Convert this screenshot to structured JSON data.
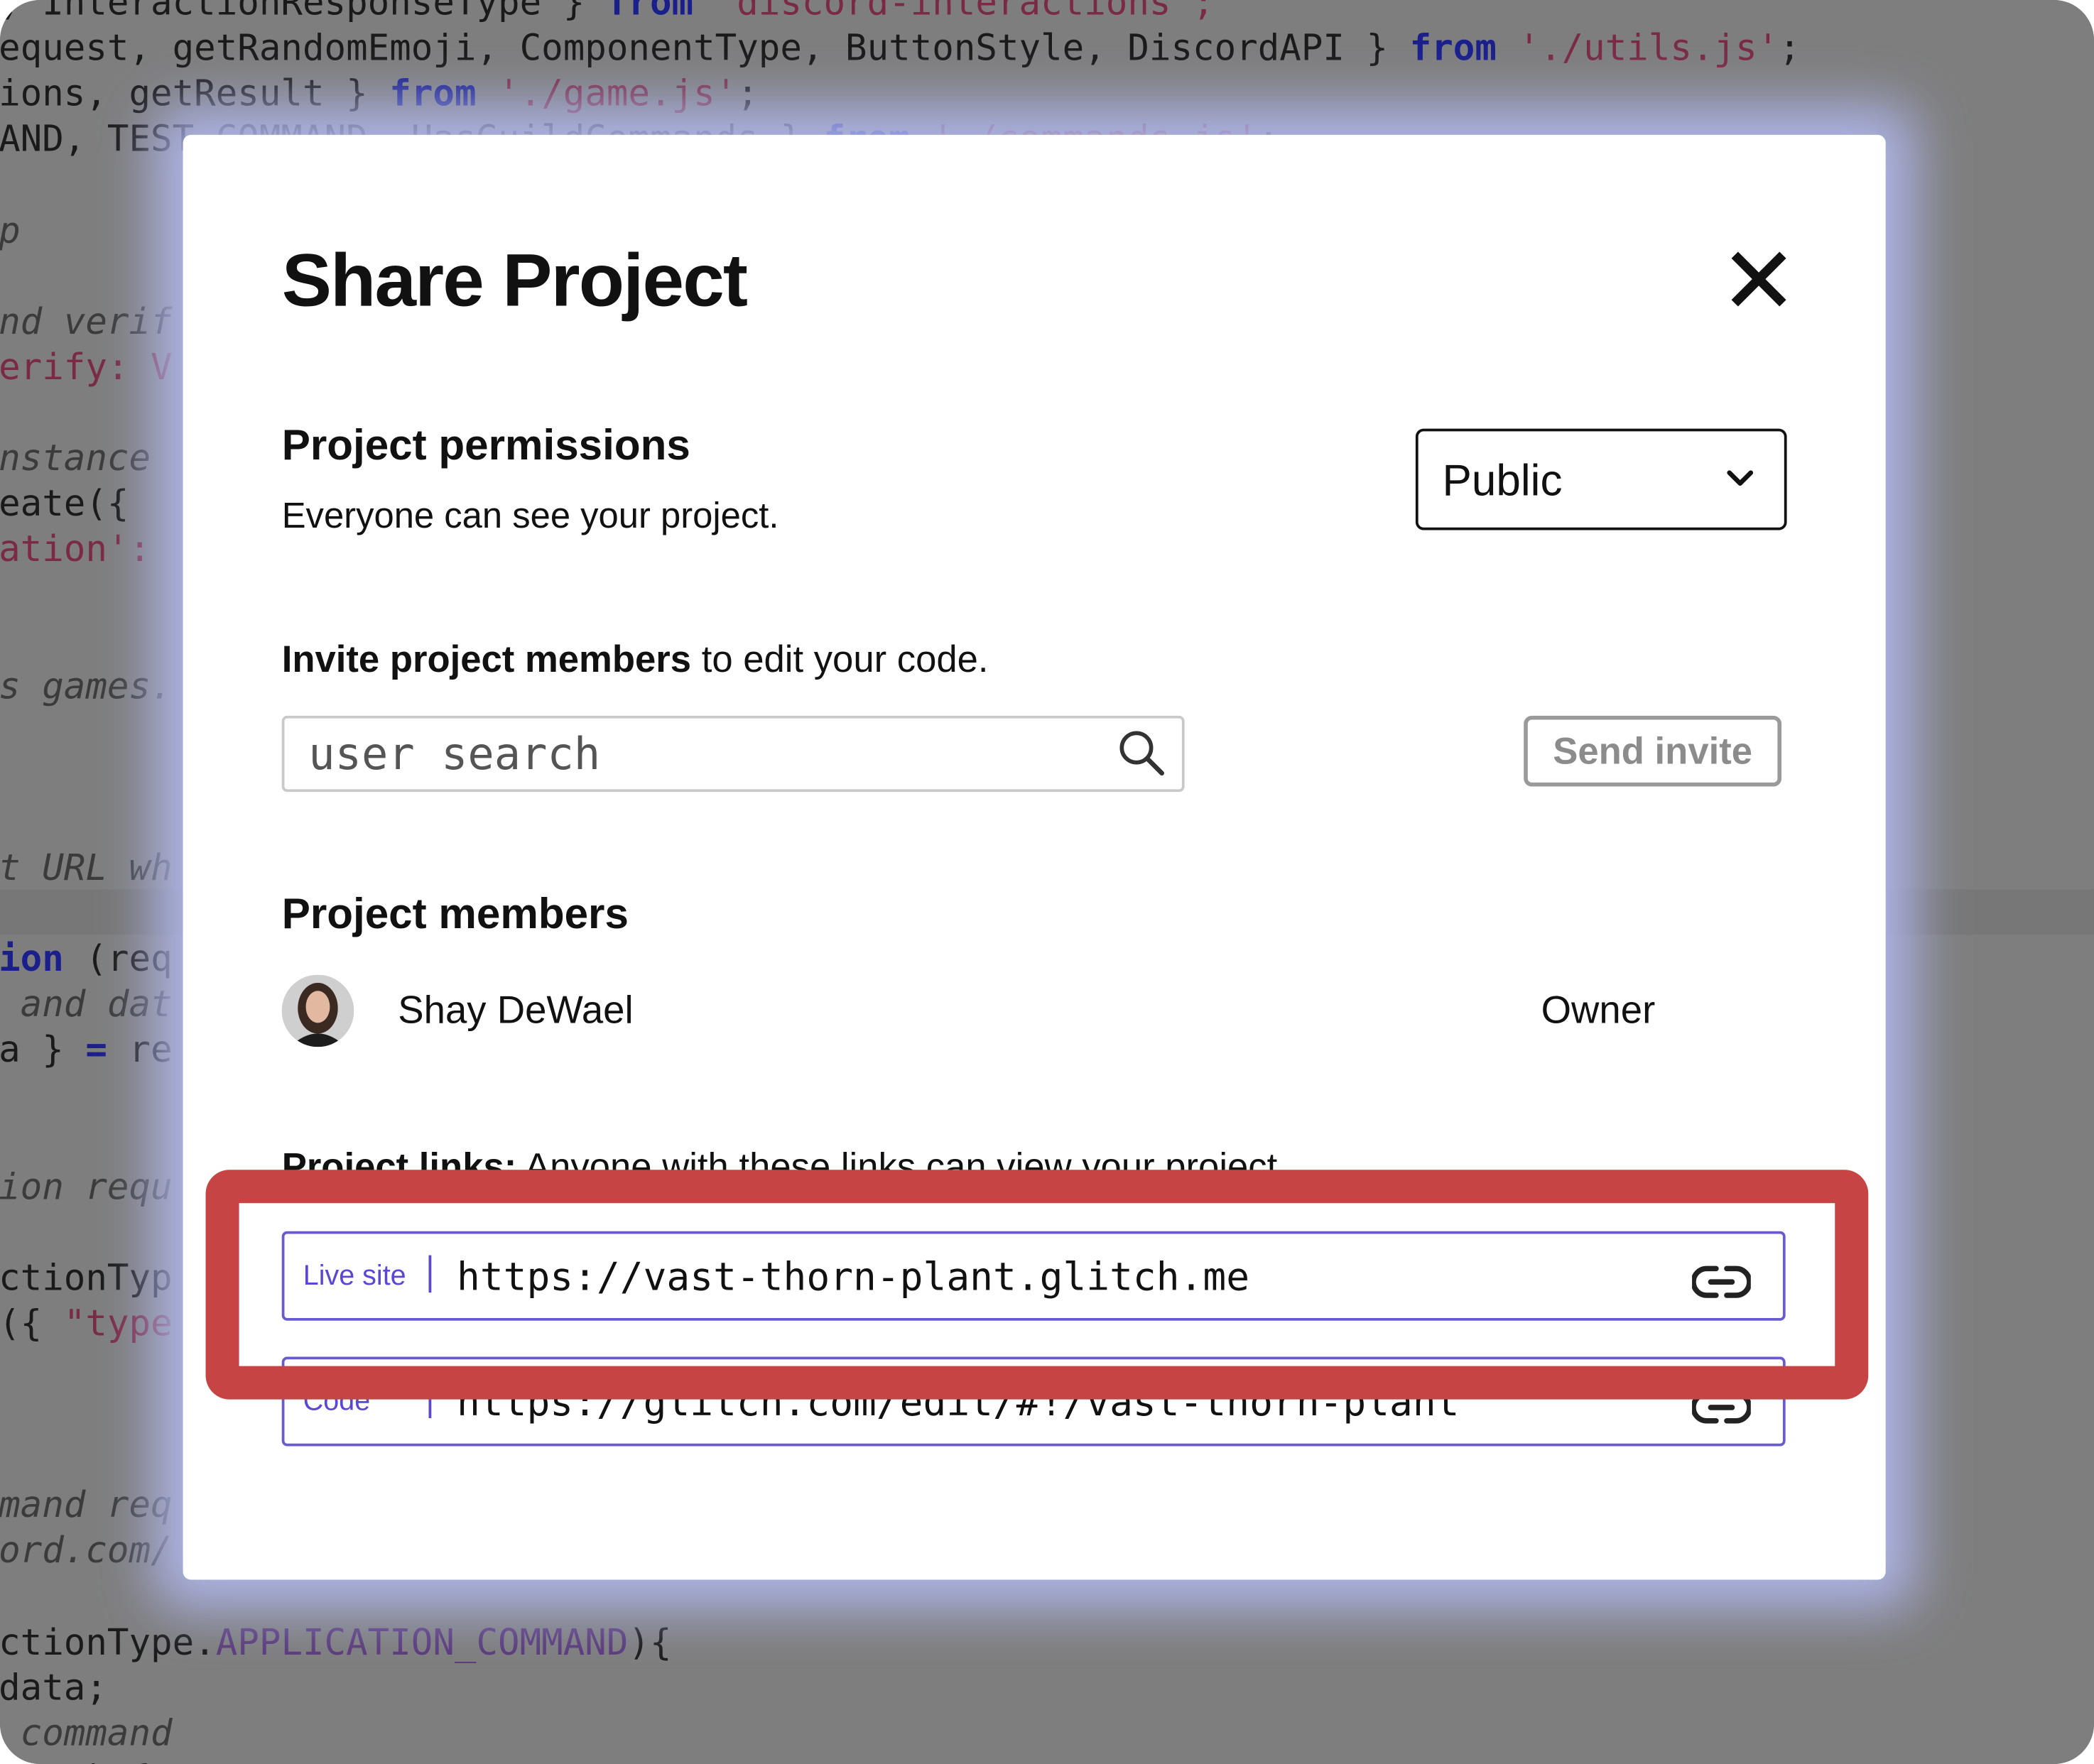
{
  "background_code": {
    "lines": [
      {
        "segments": [
          {
            "t": ", InteractionResponseType } ",
            "c": ""
          },
          {
            "t": "from",
            "c": "c-kw"
          },
          {
            "t": " 'discord-interactions';",
            "c": "c-str"
          }
        ]
      },
      {
        "segments": [
          {
            "t": "equest, getRandomEmoji, ComponentType, ButtonStyle, DiscordAPI } ",
            "c": ""
          },
          {
            "t": "from",
            "c": "c-kw"
          },
          {
            "t": " './utils.js'",
            "c": "c-str"
          },
          {
            "t": ";",
            "c": ""
          }
        ]
      },
      {
        "segments": [
          {
            "t": "ions, getResult } ",
            "c": ""
          },
          {
            "t": "from",
            "c": "c-kw"
          },
          {
            "t": " './game.js'",
            "c": "c-str"
          },
          {
            "t": ";",
            "c": ""
          }
        ]
      },
      {
        "segments": [
          {
            "t": "AND, TEST_COMMAND, HasGuildCommands } ",
            "c": ""
          },
          {
            "t": "from",
            "c": "c-kw"
          },
          {
            "t": " './commands.js'",
            "c": "c-str"
          },
          {
            "t": ";",
            "c": ""
          }
        ]
      },
      {
        "segments": []
      },
      {
        "segments": [
          {
            "t": "p",
            "c": "c-cmt"
          }
        ]
      },
      {
        "segments": []
      },
      {
        "segments": [
          {
            "t": "nd verif",
            "c": "c-cmt"
          }
        ]
      },
      {
        "segments": [
          {
            "t": "erify: V",
            "c": "c-str"
          }
        ]
      },
      {
        "segments": []
      },
      {
        "segments": [
          {
            "t": "nstance",
            "c": "c-cmt"
          }
        ]
      },
      {
        "segments": [
          {
            "t": "eate({",
            "c": ""
          }
        ]
      },
      {
        "segments": [
          {
            "t": "ation':",
            "c": "c-str"
          }
        ]
      },
      {
        "segments": []
      },
      {
        "segments": []
      },
      {
        "segments": [
          {
            "t": "s games.",
            "c": "c-cmt"
          }
        ]
      },
      {
        "segments": []
      },
      {
        "segments": []
      },
      {
        "segments": []
      },
      {
        "segments": [
          {
            "t": "t URL wh",
            "c": "c-cmt"
          }
        ]
      },
      {
        "segments": []
      },
      {
        "segments": [
          {
            "t": "ion",
            "c": "c-kw"
          },
          {
            "t": " (req",
            "c": ""
          }
        ]
      },
      {
        "segments": [
          {
            "t": " and dat",
            "c": "c-cmt"
          }
        ]
      },
      {
        "segments": [
          {
            "t": "a } ",
            "c": ""
          },
          {
            "t": "=",
            "c": "c-kw"
          },
          {
            "t": " re",
            "c": ""
          }
        ]
      },
      {
        "segments": []
      },
      {
        "segments": []
      },
      {
        "segments": [
          {
            "t": "ion requ",
            "c": "c-cmt"
          }
        ]
      },
      {
        "segments": []
      },
      {
        "segments": [
          {
            "t": "ctionTyp",
            "c": ""
          }
        ]
      },
      {
        "segments": [
          {
            "t": "({ ",
            "c": ""
          },
          {
            "t": "\"type",
            "c": "c-str"
          }
        ]
      },
      {
        "segments": []
      },
      {
        "segments": []
      },
      {
        "segments": []
      },
      {
        "segments": [
          {
            "t": "mand req",
            "c": "c-cmt"
          }
        ]
      },
      {
        "segments": [
          {
            "t": "ord.com/",
            "c": "c-cmt"
          }
        ]
      },
      {
        "segments": []
      },
      {
        "segments": [
          {
            "t": "ctionType.",
            "c": ""
          },
          {
            "t": "APPLICATION_COMMAND",
            "c": "c-const"
          },
          {
            "t": "){",
            "c": ""
          }
        ]
      },
      {
        "segments": [
          {
            "t": "data;",
            "c": ""
          }
        ]
      },
      {
        "segments": [
          {
            "t": " command",
            "c": "c-cmt"
          }
        ]
      },
      {
        "segments": [
          {
            "t": "   \") {",
            "c": ""
          }
        ]
      }
    ]
  },
  "modal": {
    "title": "Share Project",
    "close_icon": "close-x-icon",
    "permissions": {
      "title": "Project permissions",
      "description": "Everyone can see your project.",
      "select_value": "Public",
      "select_icon": "chevron-down-icon"
    },
    "invite": {
      "bold_text": "Invite project members",
      "rest_text": " to edit your code.",
      "search_placeholder": "user search",
      "search_value": "",
      "search_icon": "magnifier-icon",
      "send_label": "Send invite"
    },
    "members": {
      "title": "Project members",
      "list": [
        {
          "name": "Shay DeWael",
          "role": "Owner",
          "avatar_icon": "user-photo-avatar"
        }
      ]
    },
    "links": {
      "bold_text": "Project links:",
      "rest_text": " Anyone with these links can view your project.",
      "items": [
        {
          "label": "Live site",
          "url": "https://vast-thorn-plant.glitch.me",
          "icon": "link-icon"
        },
        {
          "label": "Code",
          "url": "https://glitch.com/edit/#!/vast-thorn-plant",
          "icon": "link-icon"
        }
      ]
    }
  },
  "colors": {
    "overlay": "#808080",
    "modal_glow": "#afb6eb",
    "link_accent": "#5b47d6",
    "highlight_red": "#c64444"
  }
}
